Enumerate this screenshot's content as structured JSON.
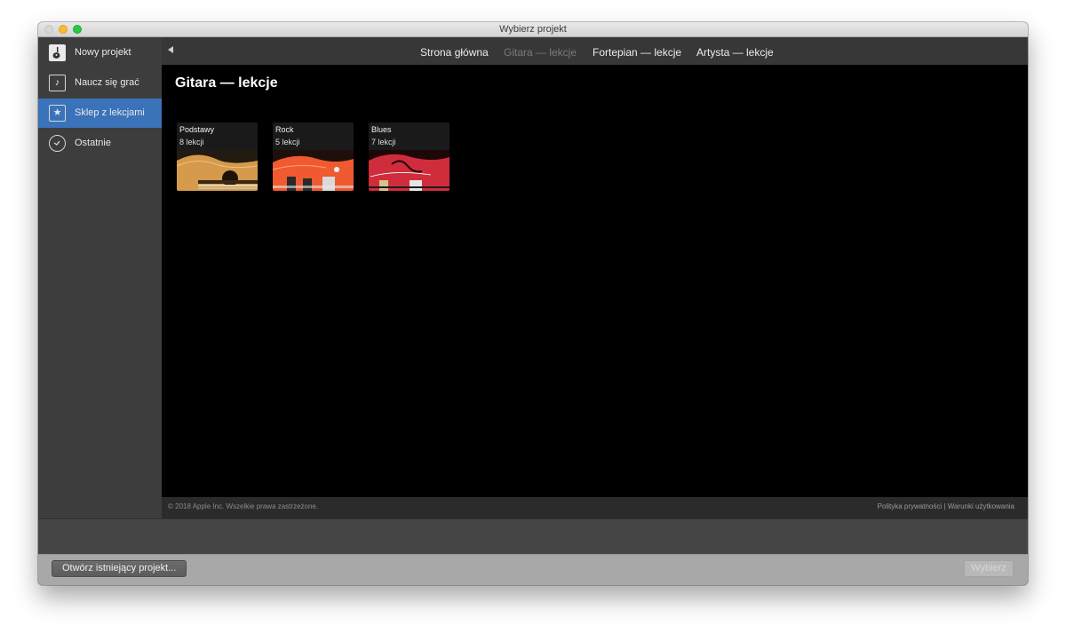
{
  "window": {
    "title": "Wybierz projekt"
  },
  "sidebar": {
    "items": [
      {
        "label": "Nowy projekt",
        "icon": "new-project-icon"
      },
      {
        "label": "Naucz się grać",
        "icon": "music-note-icon"
      },
      {
        "label": "Sklep z lekcjami",
        "icon": "star-icon",
        "selected": true
      },
      {
        "label": "Ostatnie",
        "icon": "clock-icon"
      }
    ]
  },
  "topnav": {
    "back_icon": "back-arrow-icon",
    "links": [
      {
        "label": "Strona główna"
      },
      {
        "label": "Gitara — lekcje",
        "active": true
      },
      {
        "label": "Fortepian — lekcje"
      },
      {
        "label": "Artysta — lekcje"
      }
    ]
  },
  "main": {
    "title": "Gitara — lekcje",
    "cards": [
      {
        "title": "Podstawy",
        "subtitle": "8 lekcji",
        "color": "#d59a4c"
      },
      {
        "title": "Rock",
        "subtitle": "5 lekcji",
        "color": "#ef5a30"
      },
      {
        "title": "Blues",
        "subtitle": "7 lekcji",
        "color": "#cf2d3c"
      }
    ]
  },
  "footer": {
    "copyright": "© 2018 Apple Inc. Wszelkie prawa zastrzeżone.",
    "privacy": "Polityka prywatności",
    "separator": "|",
    "terms": "Warunki użytkowania"
  },
  "bottom": {
    "open_label": "Otwórz istniejący projekt...",
    "select_label": "Wybierz"
  },
  "colors": {
    "accent": "#3a73b9",
    "content_bg": "#000000",
    "sidebar_bg": "#3d3d3d"
  }
}
